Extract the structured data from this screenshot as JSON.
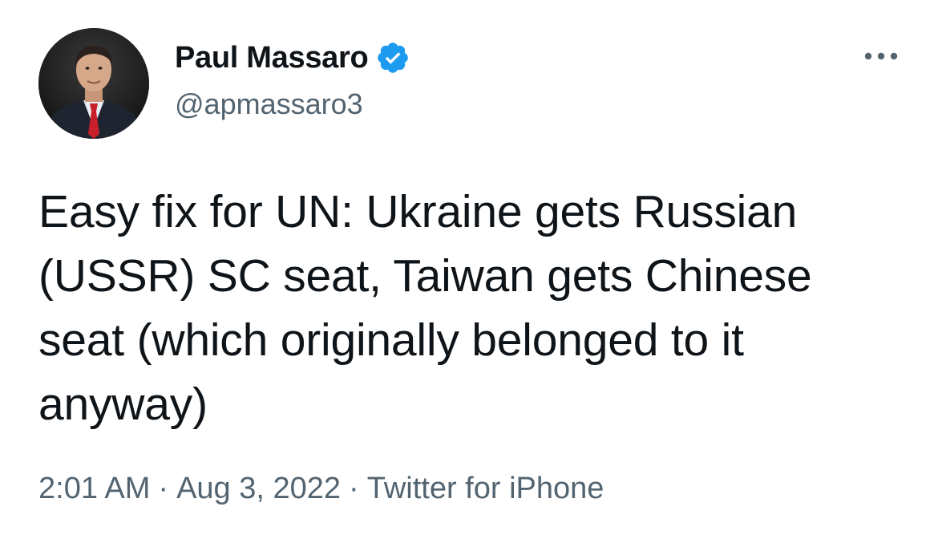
{
  "author": {
    "display_name": "Paul Massaro",
    "handle": "@apmassaro3",
    "avatar_icon": "profile-photo",
    "verified_icon": "verified-badge-icon",
    "verified_color": "#1d9bf0"
  },
  "tweet": {
    "text": "Easy fix for UN: Ukraine gets Russian (USSR) SC seat, Taiwan gets Chinese seat (which originally belonged to it anyway)"
  },
  "meta": {
    "time": "2:01 AM",
    "separator": "·",
    "date": "Aug 3, 2022",
    "source": "Twitter for iPhone"
  },
  "menu": {
    "icon": "more-options-icon"
  }
}
